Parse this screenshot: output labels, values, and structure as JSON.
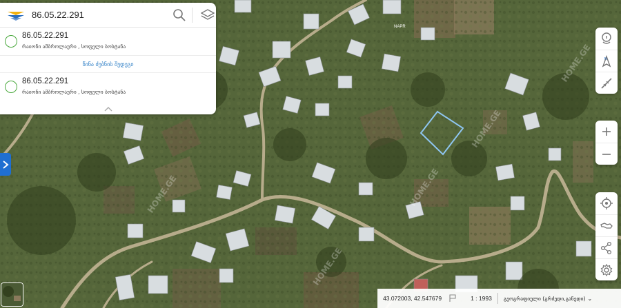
{
  "search": {
    "value": "86.05.22.291"
  },
  "results": [
    {
      "code": "86.05.22.291",
      "address": "რაიონი ამბროლაური , სოფელი ბოსტანა"
    },
    {
      "code": "86.05.22.291",
      "address": "რაიონი ამბროლაური , სოფელი ბოსტანა"
    }
  ],
  "prev_search_label": "წინა ძებნის შედეგი",
  "map": {
    "place_label": "NAPR",
    "watermark": "HOME.GE",
    "parcel_color": "#8ec5f0"
  },
  "status": {
    "coordinates": "43.072003, 42.547679",
    "scale": "1 : 1993",
    "projection": "გეოგრაფიული (გრძედი,განედი)"
  },
  "icons": {
    "logo": "napr-logo",
    "search": "search-icon",
    "layers": "layers-icon",
    "expand": "chevron-right-icon",
    "collapse": "chevron-up-icon"
  },
  "colors": {
    "accent": "#1f6fd1",
    "result_marker": "#49a83c",
    "link": "#2f7fc6"
  }
}
